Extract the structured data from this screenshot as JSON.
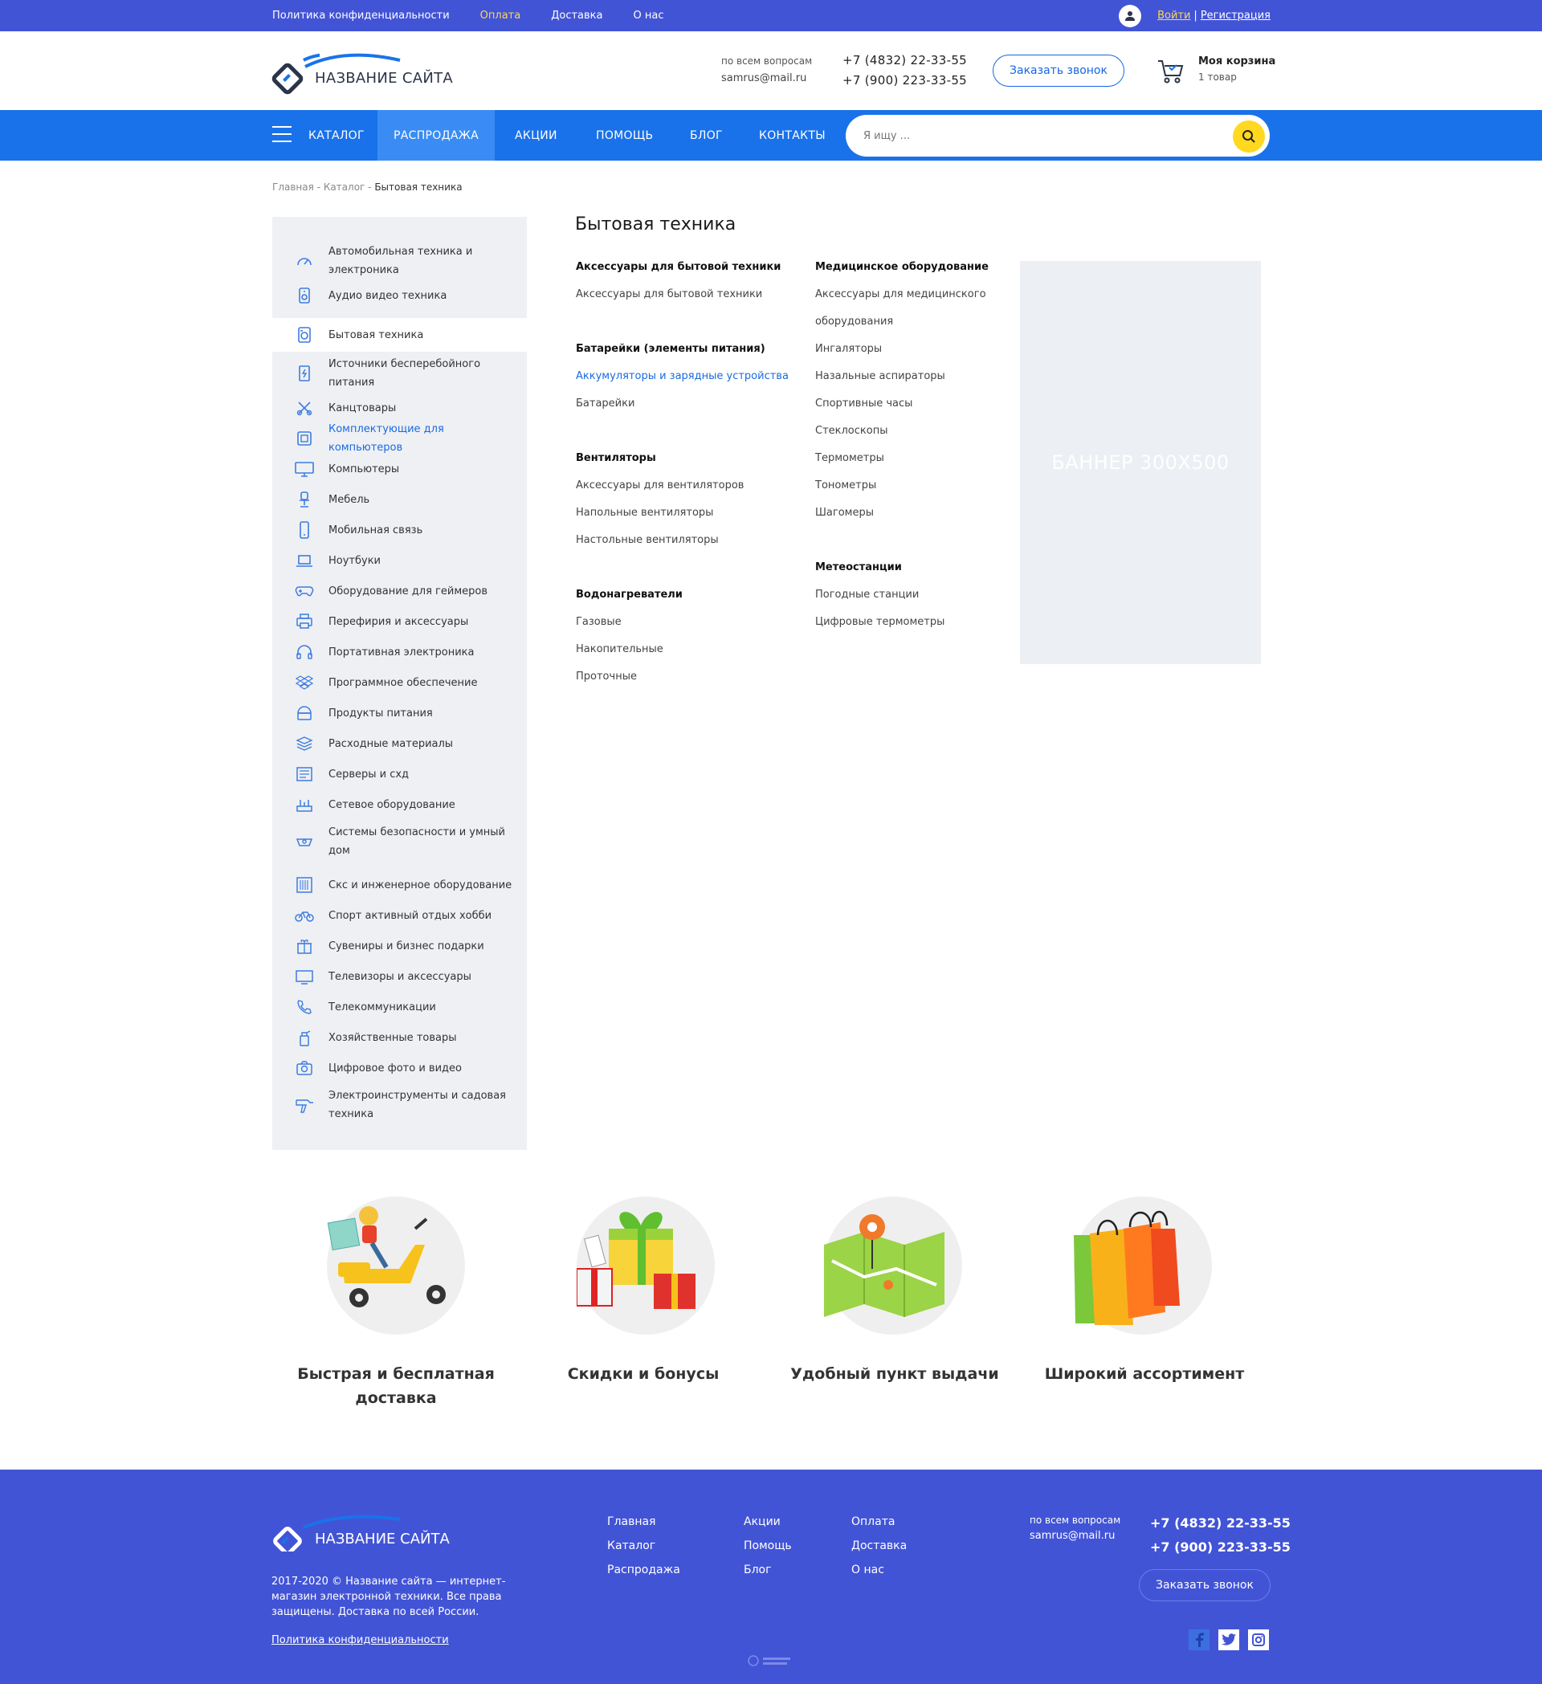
{
  "topbar": {
    "links": [
      {
        "label": "Политика конфиденциальности",
        "active": false
      },
      {
        "label": "Оплата",
        "active": true
      },
      {
        "label": "Доставка",
        "active": false
      },
      {
        "label": "О нас",
        "active": false
      }
    ],
    "login": "Войти",
    "separator": "|",
    "register": "Регистрация"
  },
  "header": {
    "logo_text": "НАЗВАНИЕ САЙТА",
    "contact_label": "по всем вопросам",
    "email": "samrus@mail.ru",
    "phone1": "+7 (4832) 22-33-55",
    "phone2": "+7 (900) 223-33-55",
    "callback": "Заказать звонок",
    "cart_title": "Моя корзина",
    "cart_count": "1 товар"
  },
  "nav": {
    "items": [
      {
        "label": "КАТАЛОГ",
        "active": false
      },
      {
        "label": "РАСПРОДАЖА",
        "active": true
      },
      {
        "label": "АКЦИИ",
        "active": false
      },
      {
        "label": "ПОМОЩЬ",
        "active": false
      },
      {
        "label": "БЛОГ",
        "active": false
      },
      {
        "label": "КОНТАКТЫ",
        "active": false
      }
    ],
    "search_placeholder": "Я ищу ..."
  },
  "breadcrumb": {
    "items": [
      "Главная",
      "Каталог"
    ],
    "separator": " - ",
    "current": "Бытовая техника"
  },
  "sidebar": {
    "items": [
      {
        "label": "Автомобильная техника и электроника",
        "icon": "speedometer-icon"
      },
      {
        "label": "Аудио видео техника",
        "icon": "speaker-icon"
      },
      {
        "label": "Бытовая техника",
        "icon": "washing-machine-icon",
        "active": true
      },
      {
        "label": "Источники бесперебойного питания",
        "icon": "ups-icon"
      },
      {
        "label": "Канцтовары",
        "icon": "scissors-icon"
      },
      {
        "label": "Комплектующие для компьютеров",
        "icon": "cpu-icon",
        "highlight": true
      },
      {
        "label": "Компьютеры",
        "icon": "monitor-icon"
      },
      {
        "label": "Мебель",
        "icon": "chair-icon"
      },
      {
        "label": "Мобильная связь",
        "icon": "phone-icon"
      },
      {
        "label": "Ноутбуки",
        "icon": "laptop-icon"
      },
      {
        "label": "Оборудование для геймеров",
        "icon": "gamepad-icon"
      },
      {
        "label": "Перефирия и аксессуары",
        "icon": "printer-icon"
      },
      {
        "label": "Портативная электроника",
        "icon": "headphones-icon"
      },
      {
        "label": "Программное обеспечение",
        "icon": "dropbox-icon"
      },
      {
        "label": "Продукты питания",
        "icon": "food-icon"
      },
      {
        "label": "Расходные материалы",
        "icon": "layers-icon"
      },
      {
        "label": "Серверы и схд",
        "icon": "server-icon"
      },
      {
        "label": "Сетевое оборудование",
        "icon": "router-icon"
      },
      {
        "label": "Системы безопасности и умный дом",
        "icon": "camera-dome-icon"
      },
      {
        "label": "Скс и инженерное оборудование",
        "icon": "rack-icon"
      },
      {
        "label": "Спорт активный отдых хобби",
        "icon": "bicycle-icon"
      },
      {
        "label": "Сувениры и бизнес подарки",
        "icon": "gift-icon"
      },
      {
        "label": "Телевизоры и аксессуары",
        "icon": "tv-icon"
      },
      {
        "label": "Телекоммуникации",
        "icon": "handset-icon"
      },
      {
        "label": "Хозяйственные товары",
        "icon": "spray-icon"
      },
      {
        "label": "Цифровое фото и видео",
        "icon": "photo-camera-icon"
      },
      {
        "label": "Электроинструменты и садовая техника",
        "icon": "drill-icon"
      }
    ]
  },
  "main": {
    "title": "Бытовая техника",
    "col1": [
      {
        "heading": "Аксессуары для бытовой техники",
        "links": [
          "Аксессуары для бытовой техники"
        ]
      },
      {
        "heading": "Батарейки (элементы питания)",
        "links": [
          "Аккумуляторы и зарядные устройства",
          "Батарейки"
        ],
        "highlight_index": 0
      },
      {
        "heading": "Вентиляторы",
        "links": [
          "Аксессуары для вентиляторов",
          "Напольные вентиляторы",
          "Настольные вентиляторы"
        ]
      },
      {
        "heading": "Водонагреватели",
        "links": [
          "Газовые",
          "Накопительные",
          "Проточные"
        ]
      }
    ],
    "col2": [
      {
        "heading": "Медицинское оборудование",
        "links": [
          "Аксессуары для медицинского",
          "оборудования",
          "Ингаляторы",
          "Назальные аспираторы",
          "Спортивные часы",
          "Стеклоскопы",
          "Термометры",
          "Тонометры",
          "Шагомеры"
        ]
      },
      {
        "heading": "Метеостанции",
        "links": [
          "Погодные станции",
          "Цифровые термометры"
        ]
      }
    ],
    "banner": "БАННЕР 300X500"
  },
  "features": [
    {
      "caption": "Быстрая и бесплатная доставка",
      "image": "scooter-courier-illustration"
    },
    {
      "caption": "Скидки и бонусы",
      "image": "gift-boxes-illustration"
    },
    {
      "caption": "Удобный пункт выдачи",
      "image": "map-pin-illustration"
    },
    {
      "caption": "Широкий ассортимент",
      "image": "shopping-bags-illustration"
    }
  ],
  "footer": {
    "logo_text": "НАЗВАНИЕ САЙТА",
    "copyright": "2017-2020 © Название сайта — интернет-магазин электронной техники. Все права защищены. Доставка по всей России.",
    "policy": "Политика конфиденциальности",
    "col1": [
      "Главная",
      "Каталог",
      "Распродажа"
    ],
    "col2": [
      "Акции",
      "Помощь",
      "Блог"
    ],
    "col3": [
      "Оплата",
      "Доставка",
      "О нас"
    ],
    "contact_label": "по всем вопросам",
    "email": "samrus@mail.ru",
    "phone1": "+7 (4832) 22-33-55",
    "phone2": "+7 (900) 223-33-55",
    "callback": "Заказать звонок",
    "social": [
      "facebook-icon",
      "twitter-icon",
      "instagram-icon"
    ]
  },
  "colors": {
    "topbar": "#4254d6",
    "nav": "#1a72ea",
    "nav_active": "#3a8cf4",
    "accent_yellow": "#ffd81f",
    "link_blue": "#1a6be0",
    "sidebar_bg": "#eef0f4"
  }
}
